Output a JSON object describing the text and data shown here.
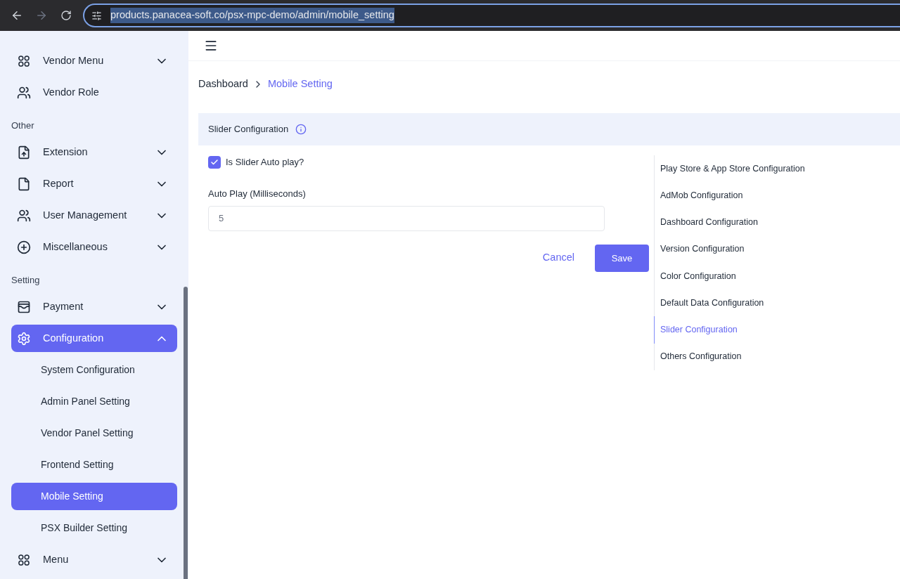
{
  "browser": {
    "url": "products.panacea-soft.co/psx-mpc-demo/admin/mobile_setting"
  },
  "sidebar": {
    "items": [
      {
        "kind": "group",
        "label": "Vendor Menu",
        "expanded": false,
        "selected": false
      },
      {
        "kind": "link",
        "label": "Vendor Role",
        "selected": false
      },
      {
        "kind": "heading",
        "label": "Other"
      },
      {
        "kind": "group",
        "label": "Extension",
        "expanded": false,
        "selected": false
      },
      {
        "kind": "group",
        "label": "Report",
        "expanded": false,
        "selected": false
      },
      {
        "kind": "group",
        "label": "User Management",
        "expanded": false,
        "selected": false
      },
      {
        "kind": "group",
        "label": "Miscellaneous",
        "expanded": false,
        "selected": false
      },
      {
        "kind": "heading",
        "label": "Setting"
      },
      {
        "kind": "group",
        "label": "Payment",
        "expanded": false,
        "selected": false
      },
      {
        "kind": "group",
        "label": "Configuration",
        "expanded": true,
        "selected": true
      },
      {
        "kind": "subitem",
        "label": "System Configuration",
        "selected": false
      },
      {
        "kind": "subitem",
        "label": "Admin Panel Setting",
        "selected": false
      },
      {
        "kind": "subitem",
        "label": "Vendor Panel Setting",
        "selected": false
      },
      {
        "kind": "subitem",
        "label": "Frontend Setting",
        "selected": false
      },
      {
        "kind": "subitem",
        "label": "Mobile Setting",
        "selected": true
      },
      {
        "kind": "subitem",
        "label": "PSX Builder Setting",
        "selected": false
      },
      {
        "kind": "group",
        "label": "Menu",
        "expanded": false,
        "selected": false
      }
    ]
  },
  "breadcrumb": [
    "Dashboard",
    "Mobile Setting"
  ],
  "panel": {
    "title": "Slider Configuration",
    "checkbox": {
      "label": "Is Slider Auto play?",
      "checked": true
    },
    "field": {
      "label": "Auto Play (Milliseconds)",
      "value": "5"
    },
    "buttons": {
      "cancel": "Cancel",
      "save": "Save"
    }
  },
  "config_nav": [
    {
      "label": "Play Store & App Store Configuration",
      "selected": false
    },
    {
      "label": "AdMob Configuration",
      "selected": false
    },
    {
      "label": "Dashboard Configuration",
      "selected": false
    },
    {
      "label": "Version Configuration",
      "selected": false
    },
    {
      "label": "Color Configuration",
      "selected": false
    },
    {
      "label": "Default Data Configuration",
      "selected": false
    },
    {
      "label": "Slider Configuration",
      "selected": true
    },
    {
      "label": "Others Configuration",
      "selected": false
    }
  ]
}
